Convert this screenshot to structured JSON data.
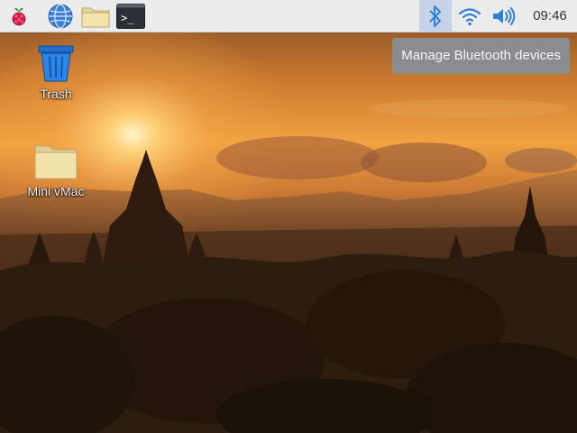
{
  "panel": {
    "launchers": [
      {
        "name": "raspberry-menu",
        "icon": "raspberry-icon"
      },
      {
        "name": "web-browser",
        "icon": "globe-icon"
      },
      {
        "name": "file-manager",
        "icon": "folder-icon"
      },
      {
        "name": "terminal",
        "icon": "terminal-icon",
        "glyph": ">_"
      }
    ],
    "tray": {
      "bluetooth_icon": "bluetooth-icon",
      "wifi_icon": "wifi-icon",
      "volume_icon": "volume-icon",
      "clock": "09:46"
    }
  },
  "tooltip": {
    "text": "Manage Bluetooth devices"
  },
  "desktop": {
    "icons": [
      {
        "label": "Trash",
        "icon": "trash-icon"
      },
      {
        "label": "Mini vMac",
        "icon": "folder-icon"
      }
    ]
  },
  "colors": {
    "panel_bg": "#ececec",
    "bluetooth_active_bg": "#c6d3e6",
    "accent_blue": "#2f80d8",
    "tooltip_bg": "#8a8c90"
  }
}
